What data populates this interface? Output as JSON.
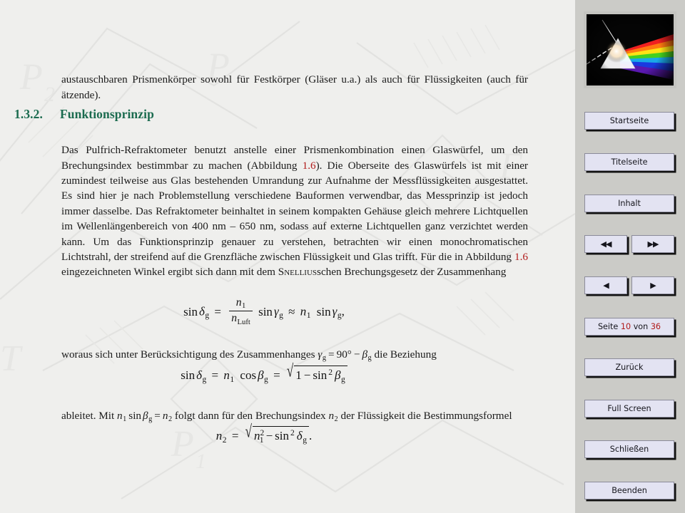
{
  "document": {
    "intro_paragraph": "austauschbaren Prismenkörper sowohl für Festkörper (Gläser u.a.) als auch für Flüssigkeiten (auch für ätzende).",
    "section_number": "1.3.2.",
    "section_title": "Funktionsprinzip",
    "body_part_1": "Das Pulfrich-Refraktometer benutzt anstelle einer Prismenkombination einen Glaswürfel, um den Brechungsindex bestimmbar zu machen (Abbildung ",
    "link_1": "1.6",
    "body_part_2": "). Die Oberseite des Glaswürfels ist mit einer zumindest teilweise aus Glas bestehenden Umrandung zur Aufnahme der Messflüssigkeiten ausgestattet. Es sind hier je nach Problemstellung verschiedene Bauformen verwendbar, das Messprinzip ist jedoch immer dasselbe. Das Refraktometer beinhaltet in seinem kompakten Gehäuse gleich mehrere Lichtquellen im Wellenlängenbereich von 400 nm – 650 nm, sodass auf externe Lichtquellen ganz verzichtet werden kann. Um das Funktionsprinzip genauer zu verstehen, betrachten wir einen monochromatischen Lichtstrahl, der streifend auf die Grenzfläche zwischen Flüssigkeit und Glas trifft. Für die in Abbildung ",
    "link_2": "1.6",
    "body_part_3": " eingezeichneten Winkel ergibt sich dann mit dem ",
    "smallcaps_name": "Snellius",
    "body_part_4": "schen Brechungsgesetz der Zusammenhang",
    "woraus_paragraph_pre": "woraus sich unter Berücksichtigung des Zusammenhanges ",
    "woraus_inline_formula": "γ_g = 90° − β_g",
    "woraus_paragraph_post": " die Beziehung",
    "ableitet_pre": "ableitet. Mit ",
    "ableitet_inline_formula": "n_1 sin β_g = n_2",
    "ableitet_post": " folgt dann für den Brechungsindex ",
    "ableitet_n2": "n_2",
    "ableitet_tail": " der Flüssigkeit die Bestimmungsformel"
  },
  "equations": {
    "eq1": "sin δ_g = n_1 / n_Luft · sin γ_g ≈ n_1 sin γ_g,",
    "eq2": "sin δ_g = n_1 cos β_g = √(1 − sin² β_g)",
    "eq3": "n_2 = √(n_1² − sin² δ_g)."
  },
  "sidebar": {
    "logo_alt": "prism-dispersion-image",
    "buttons": [
      {
        "name": "startseite",
        "label": "Startseite"
      },
      {
        "name": "titelseite",
        "label": "Titelseite"
      },
      {
        "name": "inhalt",
        "label": "Inhalt"
      },
      {
        "name": "first-page",
        "label": "◀◀"
      },
      {
        "name": "last-page",
        "label": "▶▶"
      },
      {
        "name": "prev-page",
        "label": "◀"
      },
      {
        "name": "next-page",
        "label": "▶"
      },
      {
        "name": "zurueck",
        "label": "Zurück"
      },
      {
        "name": "full-screen",
        "label": "Full Screen"
      },
      {
        "name": "schliessen",
        "label": "Schließen"
      },
      {
        "name": "beenden",
        "label": "Beenden"
      }
    ],
    "page_counter": {
      "prefix": "Seite",
      "current": "10",
      "middle": "von",
      "total": "36"
    }
  },
  "colors": {
    "heading_green": "#1b6b4f",
    "link_red": "#b01a1a",
    "sidebar_bg": "#cbcbc7",
    "button_bg": "#e3e3f2",
    "page_bg": "#efefed"
  },
  "watermark": {
    "label_top": "P2",
    "label_bottom": "P1"
  }
}
